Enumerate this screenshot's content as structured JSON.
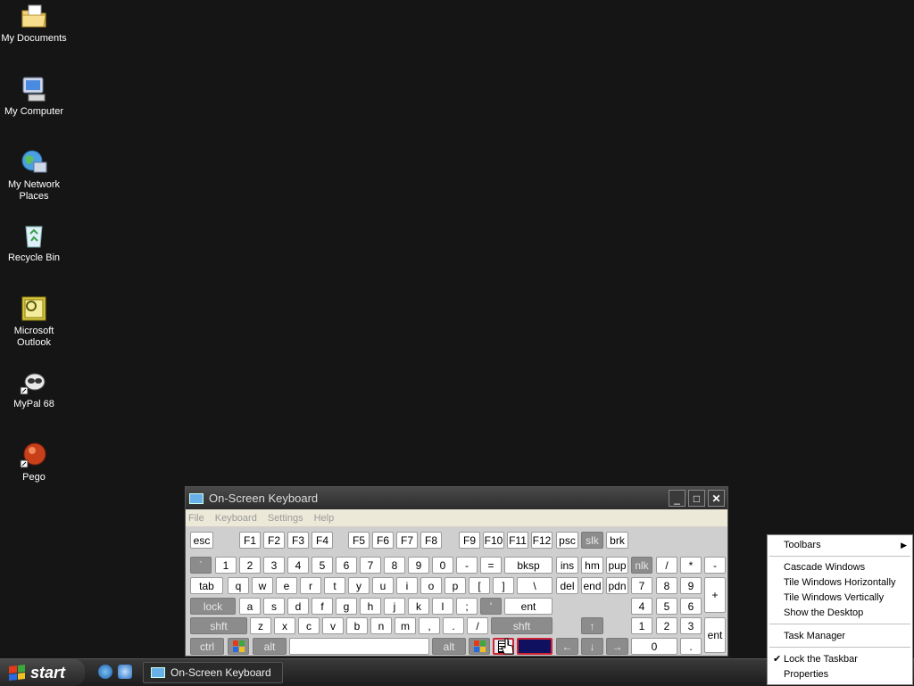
{
  "desktop": {
    "icons": [
      {
        "label": "My Documents"
      },
      {
        "label": "My Computer"
      },
      {
        "label": "My Network Places"
      },
      {
        "label": "Recycle Bin"
      },
      {
        "label": "Microsoft Outlook"
      },
      {
        "label": "MyPal 68"
      },
      {
        "label": "Pego"
      }
    ]
  },
  "osk": {
    "title": "On-Screen Keyboard",
    "menu": [
      "File",
      "Keyboard",
      "Settings",
      "Help"
    ],
    "keys": {
      "esc": "esc",
      "f1": "F1",
      "f2": "F2",
      "f3": "F3",
      "f4": "F4",
      "f5": "F5",
      "f6": "F6",
      "f7": "F7",
      "f8": "F8",
      "f9": "F9",
      "f10": "F10",
      "f11": "F11",
      "f12": "F12",
      "psc": "psc",
      "slk": "slk",
      "brk": "brk",
      "backtick": "`",
      "n1": "1",
      "n2": "2",
      "n3": "3",
      "n4": "4",
      "n5": "5",
      "n6": "6",
      "n7": "7",
      "n8": "8",
      "n9": "9",
      "n0": "0",
      "minus": "-",
      "equals": "=",
      "bksp": "bksp",
      "ins": "ins",
      "hm": "hm",
      "pup": "pup",
      "nlk": "nlk",
      "np_div": "/",
      "np_mul": "*",
      "np_sub": "-",
      "tab": "tab",
      "q": "q",
      "w": "w",
      "e": "e",
      "r": "r",
      "t": "t",
      "y": "y",
      "u": "u",
      "i": "i",
      "o": "o",
      "p": "p",
      "lbr": "[",
      "rbr": "]",
      "bslash": "\\",
      "del": "del",
      "end": "end",
      "pdn": "pdn",
      "np7": "7",
      "np8": "8",
      "np9": "9",
      "np_add": "+",
      "lock": "lock",
      "a": "a",
      "s": "s",
      "d": "d",
      "f": "f",
      "g": "g",
      "h": "h",
      "j": "j",
      "k": "k",
      "l": "l",
      "semi": ";",
      "quote": "'",
      "ent": "ent",
      "np4": "4",
      "np5": "5",
      "np6": "6",
      "shft": "shft",
      "z": "z",
      "x": "x",
      "c": "c",
      "v": "v",
      "b": "b",
      "n": "n",
      "m": "m",
      "comma": ",",
      "period": ".",
      "slash": "/",
      "shft_r": "shft",
      "up": "↑",
      "np1": "1",
      "np2": "2",
      "np3": "3",
      "np_ent": "ent",
      "ctrl": "ctrl",
      "alt": "alt",
      "alt_r": "alt",
      "left": "←",
      "down": "↓",
      "right": "→",
      "np0": "0",
      "np_dot": "."
    }
  },
  "taskbar": {
    "start_label": "start",
    "task_button": "On-Screen Keyboard"
  },
  "context_menu": {
    "toolbars": "Toolbars",
    "cascade": "Cascade Windows",
    "tile_h": "Tile Windows Horizontally",
    "tile_v": "Tile Windows Vertically",
    "show_desktop": "Show the Desktop",
    "task_manager": "Task Manager",
    "lock_taskbar": "Lock the Taskbar",
    "properties": "Properties"
  },
  "colors": {
    "desktop_bg": "#151515",
    "key_white": "#ffffff",
    "key_gray": "#8c8c8c",
    "highlight_red": "#cc2233"
  }
}
